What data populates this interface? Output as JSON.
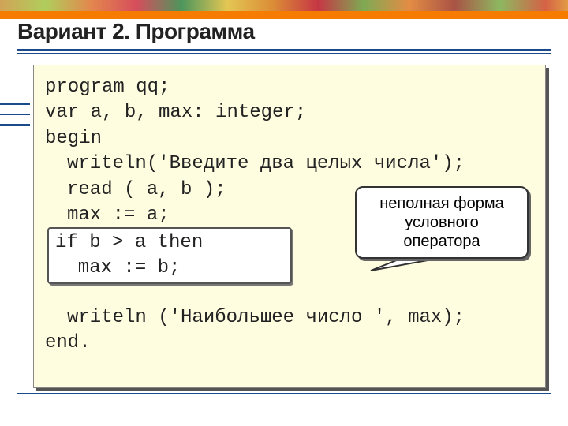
{
  "title": "Вариант 2. Программа",
  "code": {
    "l1": "program qq;",
    "l2": "var a, b, max: integer;",
    "l3": "begin",
    "l4": "writeln('Введите два целых числа');",
    "l5": "read ( a, b );",
    "l6": "max := a;",
    "l7": "if b > a then",
    "l8": "max := b;",
    "l9": "writeln ('Наибольшее число ', max);",
    "l10": "end."
  },
  "highlight": {
    "line1": "if b > a then",
    "line2": "  max := b;"
  },
  "callout": {
    "line1": "неполная форма",
    "line2": "условного",
    "line3": "оператора"
  }
}
